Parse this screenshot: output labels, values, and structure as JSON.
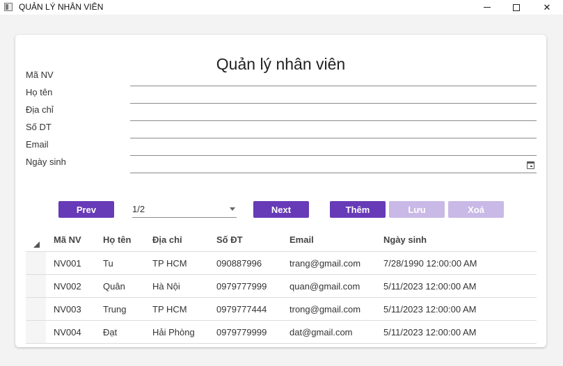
{
  "window": {
    "title": "QUẢN LÝ NHÂN VIÊN"
  },
  "form": {
    "heading": "Quản lý nhân viên",
    "fields": [
      {
        "label": "Mã NV",
        "value": ""
      },
      {
        "label": "Họ tên",
        "value": ""
      },
      {
        "label": "Địa chỉ",
        "value": ""
      },
      {
        "label": "Số DT",
        "value": ""
      },
      {
        "label": "Email",
        "value": ""
      },
      {
        "label": "Ngày sinh",
        "value": ""
      }
    ]
  },
  "pager": {
    "prev_label": "Prev",
    "next_label": "Next",
    "page_value": "1/2"
  },
  "actions": {
    "add_label": "Thêm",
    "save_label": "Lưu",
    "delete_label": "Xoá"
  },
  "table": {
    "columns": [
      "Mã NV",
      "Họ tên",
      "Địa chỉ",
      "Số ĐT",
      "Email",
      "Ngày sinh"
    ],
    "rows": [
      [
        "NV001",
        "Tu",
        "TP HCM",
        "090887996",
        "trang@gmail.com",
        "7/28/1990 12:00:00 AM"
      ],
      [
        "NV002",
        "Quân",
        "Hà Nội",
        "0979777999",
        "quan@gmail.com",
        "5/11/2023 12:00:00 AM"
      ],
      [
        "NV003",
        "Trung",
        "TP HCM",
        "0979777444",
        "trong@gmail.com",
        "5/11/2023 12:00:00 AM"
      ],
      [
        "NV004",
        "Đạt",
        "Hải Phòng",
        "0979779999",
        "dat@gmail.com",
        "5/11/2023 12:00:00 AM"
      ]
    ]
  },
  "colors": {
    "accent": "#673ab7",
    "accent_disabled": "#c9b9e6",
    "card": "#ffffff",
    "window_bg": "#f3f3f3"
  }
}
